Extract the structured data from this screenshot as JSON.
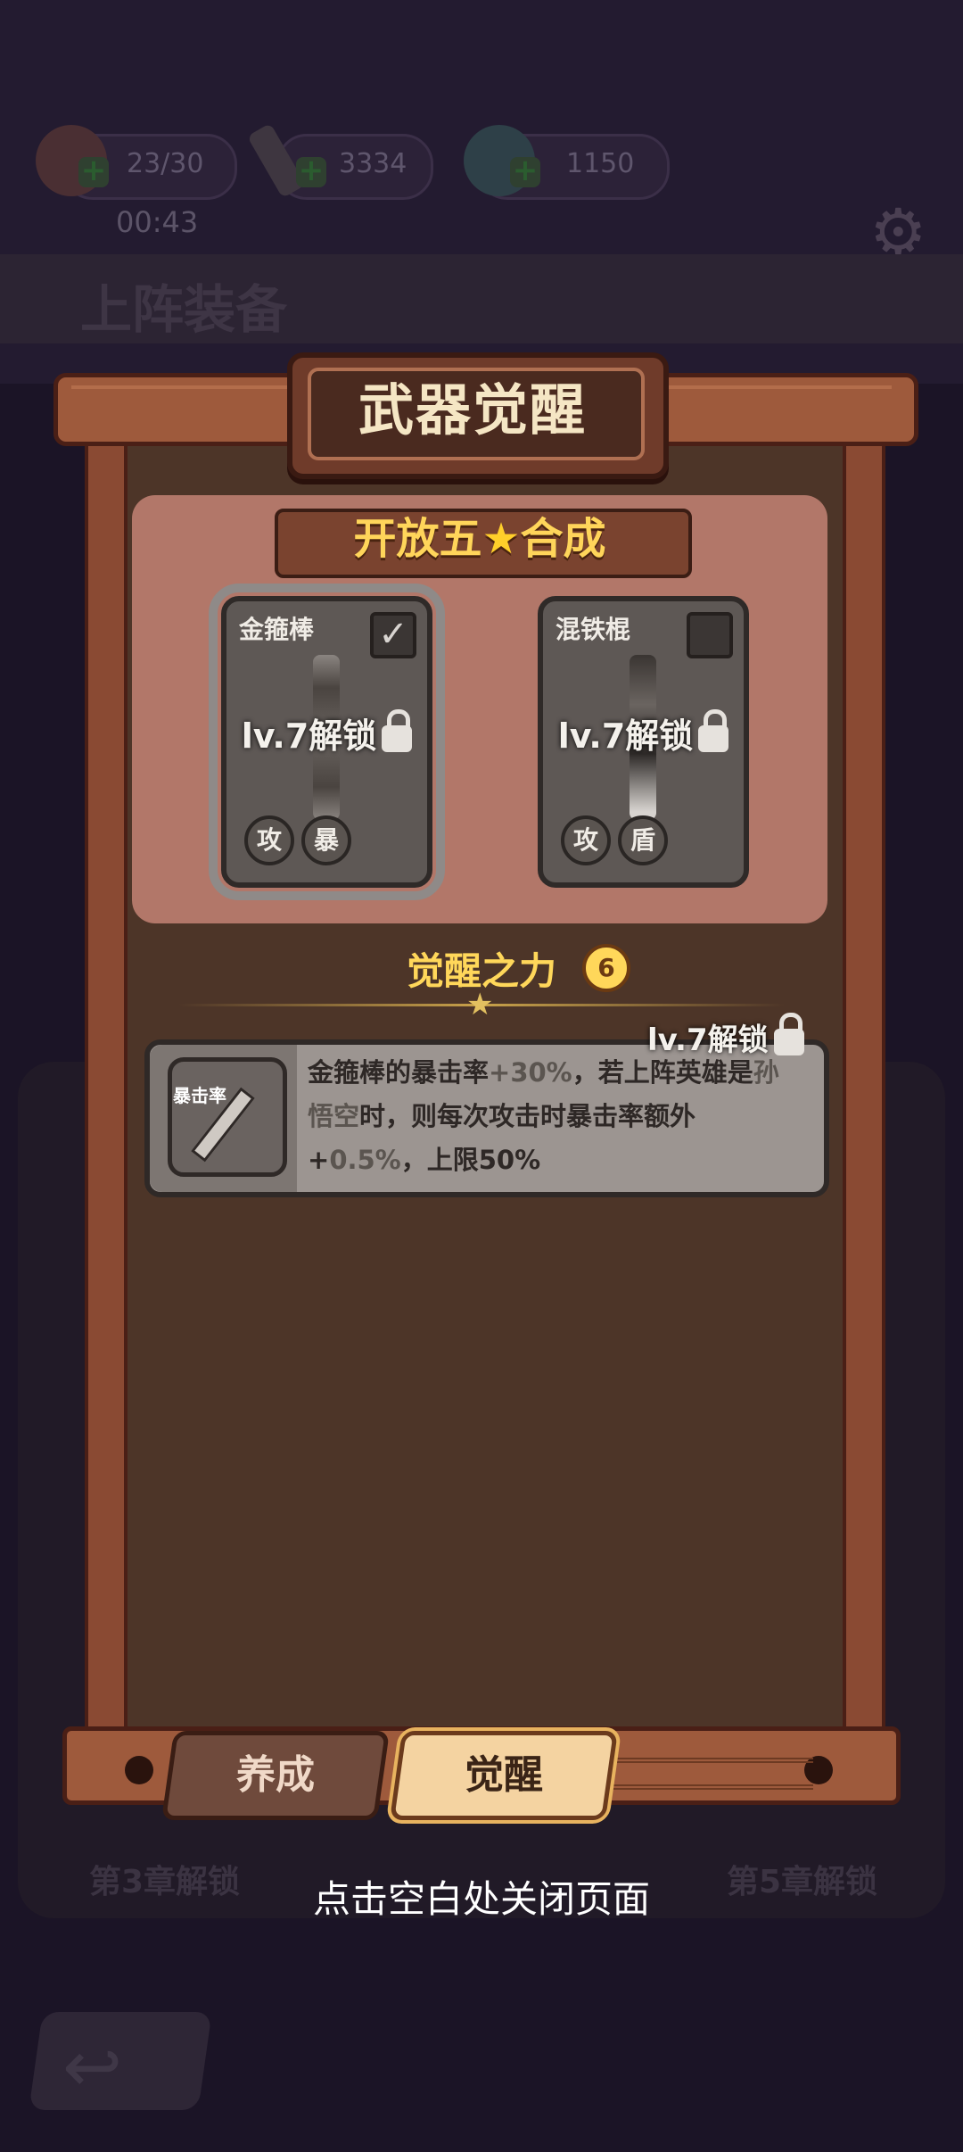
{
  "header": {
    "resources": [
      {
        "icon": "peach-icon",
        "value": "23/30"
      },
      {
        "icon": "sword-icon",
        "value": "3334"
      },
      {
        "icon": "gourd-icon",
        "value": "1150"
      }
    ],
    "timer": "00:43",
    "section_title": "上阵装备"
  },
  "modal": {
    "title": "武器觉醒",
    "ribbon": {
      "left": "开放五",
      "right": "合成"
    },
    "cards": [
      {
        "name": "金箍棒",
        "lock": "lv.7解锁",
        "tags": [
          "攻",
          "暴"
        ],
        "selected": true
      },
      {
        "name": "混铁棍",
        "lock": "lv.7解锁",
        "tags": [
          "攻",
          "盾"
        ],
        "selected": false
      }
    ],
    "awaken": {
      "title": "觉醒之力",
      "badge": "6",
      "lock": "lv.7解锁",
      "icon_label": "暴击率",
      "desc": {
        "p1": "金箍棒的暴击率",
        "p2": "+30%",
        "p3": "，若上阵英雄是",
        "p4": "孙悟空",
        "p5": "时，则每次攻击时暴击率额外+",
        "p6": "0.5%",
        "p7": "，上限50%"
      }
    },
    "tabs": [
      "养成",
      "觉醒"
    ],
    "active_tab": "觉醒"
  },
  "background": {
    "chapters": [
      "第3章解锁",
      "第5章解锁"
    ]
  },
  "close_hint": "点击空白处关闭页面",
  "colors": {
    "accent": "#ffd75a",
    "board": "#4d3528",
    "frame": "#9e5a3c"
  }
}
